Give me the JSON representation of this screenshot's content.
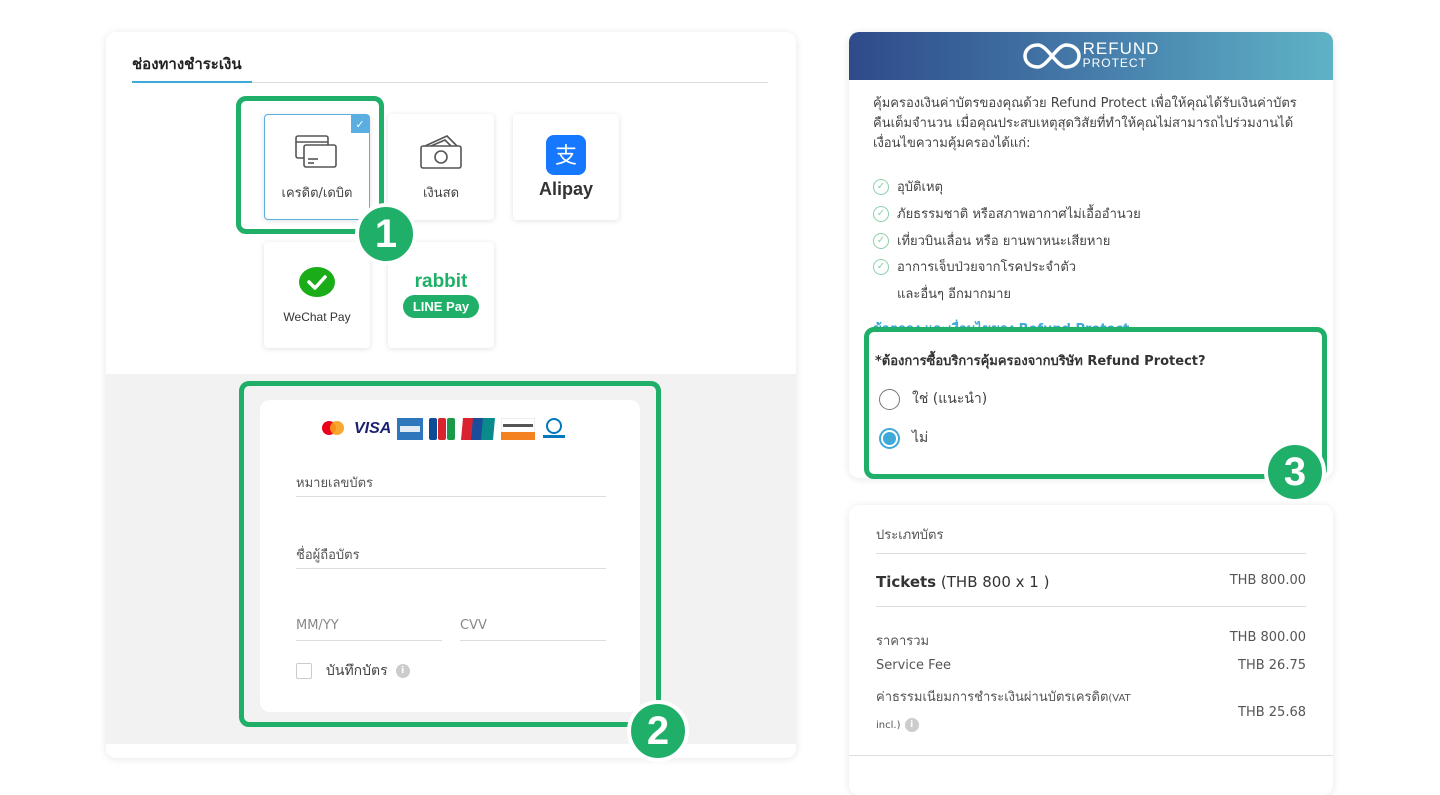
{
  "payment": {
    "title": "ช่องทางชำระเงิน",
    "methods": [
      {
        "label": "เครดิต/เดบิต",
        "icon": "credit-card-icon"
      },
      {
        "label": "เงินสด",
        "icon": "cash-icon"
      },
      {
        "label": "Alipay",
        "icon": "alipay-logo"
      },
      {
        "label": "WeChat Pay",
        "icon": "wechat-pay-logo"
      },
      {
        "label": "LINE Pay",
        "brand": "rabbit",
        "icon": "rabbit-line-pay-logo"
      }
    ],
    "card_brands": [
      "VISA"
    ],
    "card_number_placeholder": "หมายเลขบัตร",
    "card_holder_placeholder": "ชื่อผู้ถือบัตร",
    "expiry_placeholder": "MM/YY",
    "cvv_placeholder": "CVV",
    "save_card_label": "บันทึกบัตร"
  },
  "refund": {
    "logo_main": "REFUND",
    "logo_sub": "PROTECT",
    "intro": "คุ้มครองเงินค่าบัตรของคุณด้วย Refund Protect เพื่อให้คุณได้รับเงินค่าบัตรคืนเต็มจำนวน เมื่อคุณประสบเหตุสุดวิสัยที่ทำให้คุณไม่สามารถไปร่วมงานได้ เงื่อนไขความคุ้มครองได้แก่:",
    "items": [
      "อุบัติเหตุ",
      "ภัยธรรมชาติ หรือสภาพอากาศไม่เอื้ออำนวย",
      "เที่ยวบินเลื่อน หรือ ยานพาหนะเสียหาย",
      "อาการเจ็บป่วยจากโรคประจำตัว"
    ],
    "more": "และอื่นๆ อีกมากมาย",
    "terms_link": "ข้อตกลง และเงื่อนไขของ Refund Protect",
    "question": "*ต้องการซื้อบริการคุ้มครองจากบริษัท Refund Protect?",
    "option_yes": "ใช่ (แนะนำ)",
    "option_no": "ไม่",
    "selected": "no"
  },
  "summary": {
    "title": "ประเภทบัตร",
    "ticket_name": "Tickets",
    "ticket_detail": "(THB 800 x 1 )",
    "ticket_amount": "THB 800.00",
    "total_label": "ราคารวม",
    "total_amount": "THB 800.00",
    "service_label": "Service Fee",
    "service_amount": "THB 26.75",
    "cc_fee_label": "ค่าธรรมเนียมการชำระเงินผ่านบัตรเครดิต",
    "cc_fee_suffix": "(VAT",
    "cc_fee_suffix2": "incl.)",
    "cc_fee_amount": "THB 25.68"
  },
  "annotations": [
    "1",
    "2",
    "3"
  ],
  "colors": {
    "highlight": "#1faf68",
    "accent": "#3fa9d8",
    "radio": "#3fa9d8"
  }
}
